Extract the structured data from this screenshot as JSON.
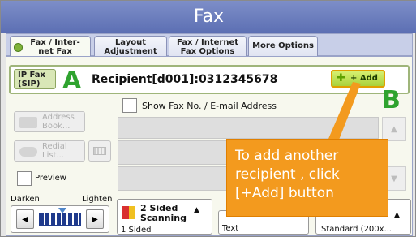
{
  "window": {
    "title": "Fax"
  },
  "tabs": [
    {
      "label": "Fax / Inter-\nnet Fax",
      "active": true
    },
    {
      "label": "Layout\nAdjustment",
      "active": false
    },
    {
      "label": "Fax / Internet\nFax Options",
      "active": false
    },
    {
      "label": "More Options",
      "active": false
    }
  ],
  "recipient": {
    "type_label": "IP Fax\n(SIP)",
    "value": "Recipient[d001]:0312345678",
    "add_label": "+ Add"
  },
  "markers": {
    "a": "A",
    "b": "B"
  },
  "show_fax_no_label": "Show Fax No. / E-mail Address",
  "side_buttons": {
    "address_book": "Address\nBook...",
    "redial": "Redial\nList..."
  },
  "preview_label": "Preview",
  "density": {
    "darken": "Darken",
    "lighten": "Lighten"
  },
  "scan": {
    "label": "2 Sided\nScanning",
    "value": "1 Sided"
  },
  "image_type": {
    "value": "Text"
  },
  "resolution": {
    "value": "Standard (200x..."
  },
  "callout": {
    "line1": "To add another",
    "line2": "recipient , click",
    "line3": "[+Add] button"
  },
  "colors": {
    "callout": "#f39a1e",
    "marker": "#2fa32f",
    "add_button": "#b7dc48"
  },
  "icons": [
    "address-book-icon",
    "redial-icon",
    "keyboard-icon",
    "add-plus-icon",
    "scan-sides-icon"
  ]
}
